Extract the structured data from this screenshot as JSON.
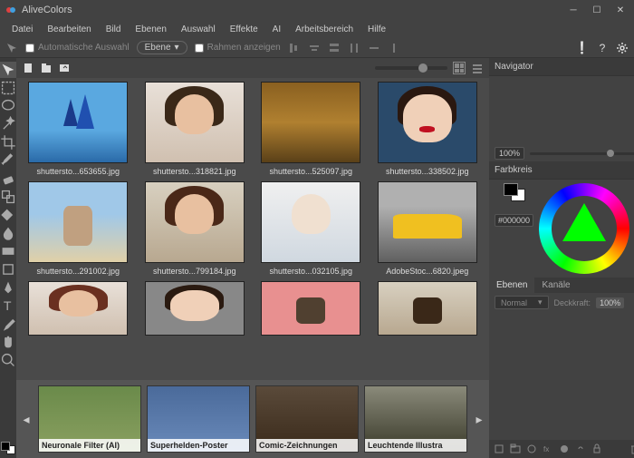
{
  "app": {
    "title": "AliveColors"
  },
  "menu": [
    "Datei",
    "Bearbeiten",
    "Bild",
    "Ebenen",
    "Auswahl",
    "Effekte",
    "AI",
    "Arbeitsbereich",
    "Hilfe"
  ],
  "toolbar": {
    "auto_select": "Automatische Auswahl",
    "layer_select": "Ebene",
    "show_frame": "Rahmen anzeigen"
  },
  "navigator": {
    "title": "Navigator",
    "zoom": "100%"
  },
  "colorpanel": {
    "title": "Farbkreis",
    "hex": "#000000"
  },
  "layers": {
    "tab_layers": "Ebenen",
    "tab_channels": "Kanäle",
    "blend": "Normal",
    "opacity_label": "Deckkraft:",
    "opacity": "100%"
  },
  "thumbs": [
    {
      "label": "shuttersto...653655.jpg"
    },
    {
      "label": "shuttersto...318821.jpg"
    },
    {
      "label": "shuttersto...525097.jpg"
    },
    {
      "label": "shuttersto...338502.jpg"
    },
    {
      "label": "shuttersto...291002.jpg"
    },
    {
      "label": "shuttersto...799184.jpg"
    },
    {
      "label": "shuttersto...032105.jpg"
    },
    {
      "label": "AdobeStoc...6820.jpeg"
    }
  ],
  "presets": [
    {
      "label": "Neuronale Filter (AI)"
    },
    {
      "label": "Superhelden-Poster"
    },
    {
      "label": "Comic-Zeichnungen"
    },
    {
      "label": "Leuchtende Illustra"
    }
  ]
}
